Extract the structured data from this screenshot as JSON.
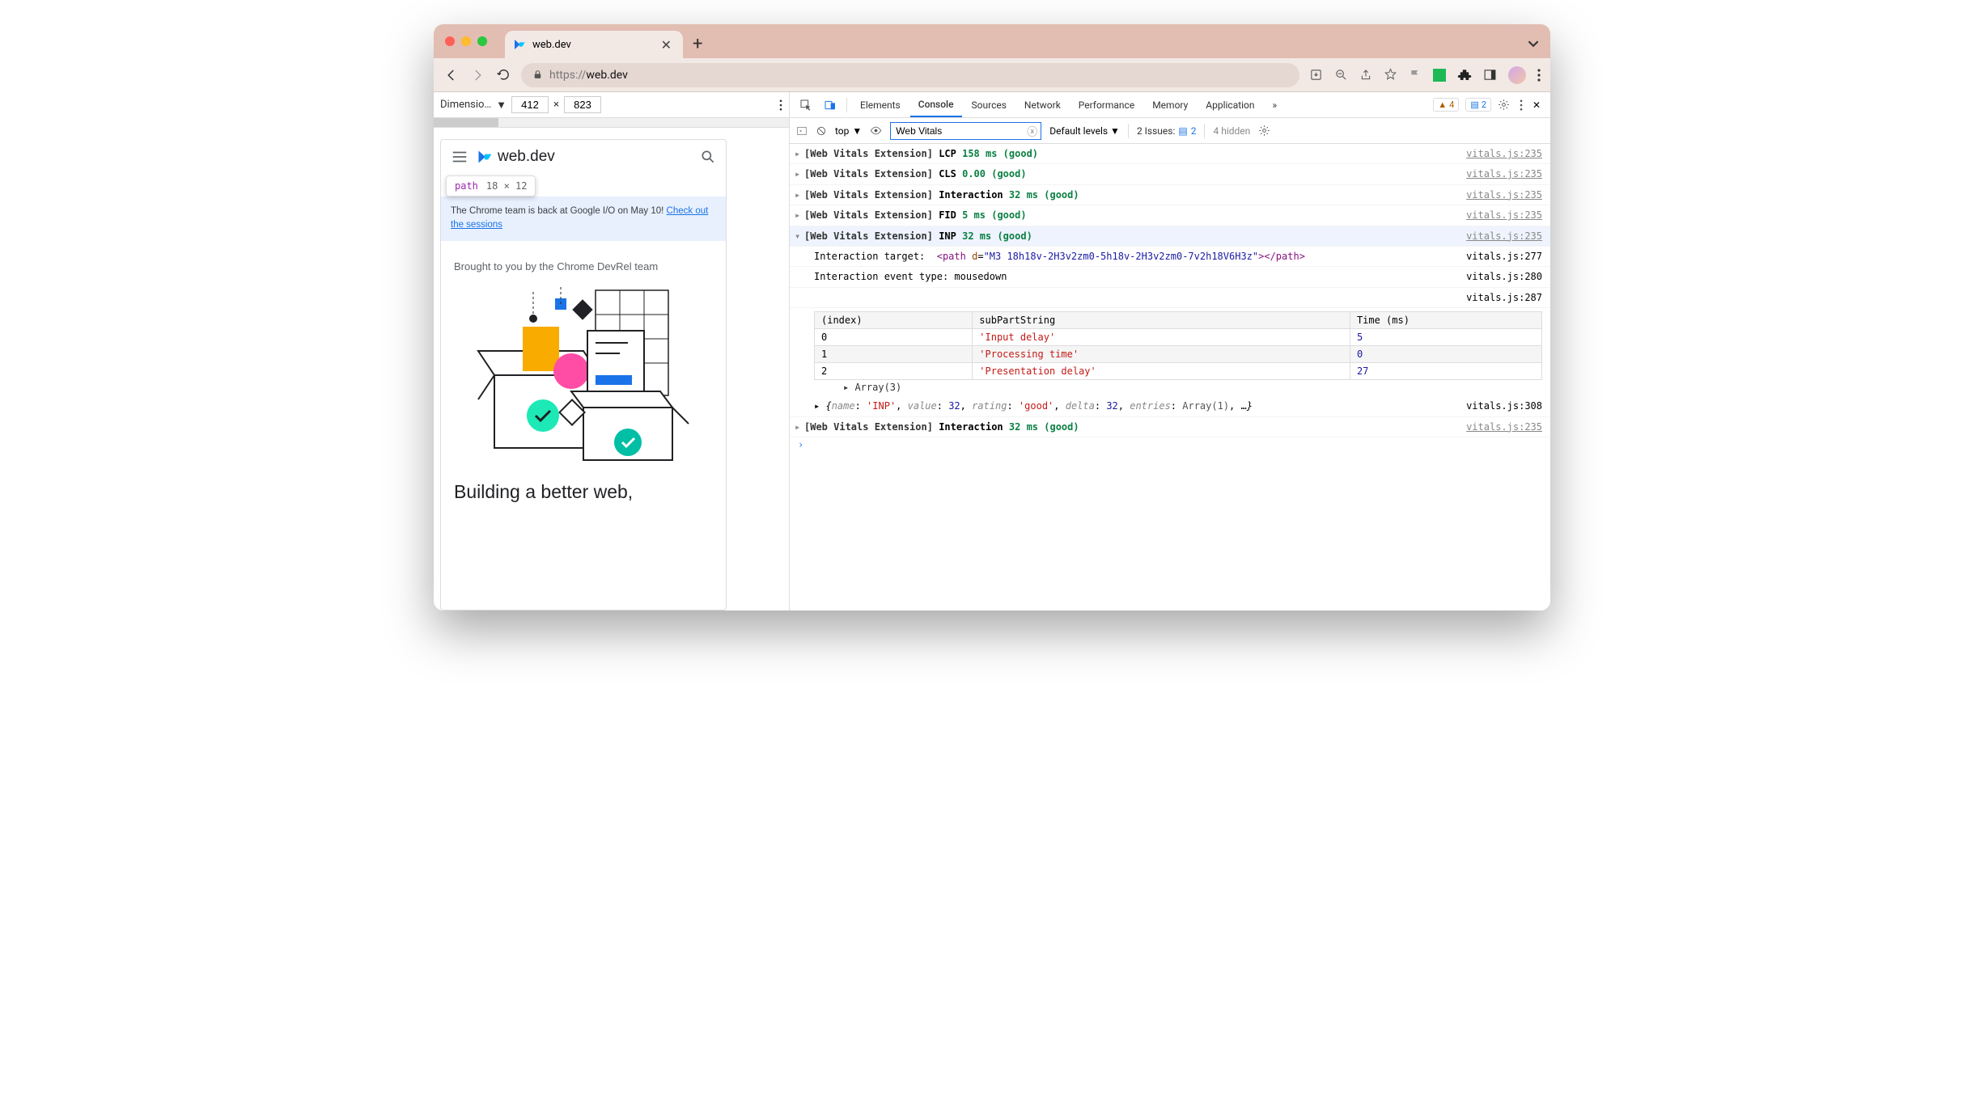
{
  "browser": {
    "tab_title": "web.dev",
    "url": "https://web.dev",
    "url_prefix": "https://"
  },
  "dimensions": {
    "label": "Dimensio…",
    "width": "412",
    "separator": "×",
    "height": "823"
  },
  "tooltip": {
    "tag": "path",
    "dims": "18 × 12"
  },
  "preview": {
    "brand": "web.dev",
    "banner_text": "The Chrome team is back at Google I/O on May 10! ",
    "banner_link": "Check out the sessions",
    "subtitle": "Brought to you by the Chrome DevRel team",
    "headline": "Building a better web,"
  },
  "devtools": {
    "panels": [
      "Elements",
      "Console",
      "Sources",
      "Network",
      "Performance",
      "Memory",
      "Application"
    ],
    "active_panel": "Console",
    "badges": {
      "warn": "4",
      "info": "2"
    },
    "context": "top",
    "filter": "Web Vitals",
    "levels": "Default levels",
    "issues_label": "2 Issues:",
    "issues_count": "2",
    "hidden": "4 hidden"
  },
  "logs": [
    {
      "prefix": "[Web Vitals Extension]",
      "metric": "LCP",
      "value": "158 ms (good)",
      "src": "vitals.js:235"
    },
    {
      "prefix": "[Web Vitals Extension]",
      "metric": "CLS",
      "value": "0.00 (good)",
      "src": "vitals.js:235"
    },
    {
      "prefix": "[Web Vitals Extension]",
      "metric": "Interaction",
      "value": "32 ms (good)",
      "src": "vitals.js:235"
    },
    {
      "prefix": "[Web Vitals Extension]",
      "metric": "FID",
      "value": "5 ms (good)",
      "src": "vitals.js:235"
    }
  ],
  "expanded": {
    "prefix": "[Web Vitals Extension]",
    "metric": "INP",
    "value": "32 ms (good)",
    "src": "vitals.js:235",
    "target_label": "Interaction target:",
    "target_html": "<path d=\"M3 18h18v-2H3v2zm0-5h18v-2H3v2zm0-7v2h18V6H3z\"></path>",
    "target_src": "vitals.js:277",
    "event_label": "Interaction event type:",
    "event_type": "mousedown",
    "event_src": "vitals.js:280",
    "table_src": "vitals.js:287",
    "table": {
      "headers": [
        "(index)",
        "subPartString",
        "Time (ms)"
      ],
      "rows": [
        [
          "0",
          "'Input delay'",
          "5"
        ],
        [
          "1",
          "'Processing time'",
          "0"
        ],
        [
          "2",
          "'Presentation delay'",
          "27"
        ]
      ],
      "footer": "Array(3)"
    },
    "obj": "{name: 'INP', value: 32, rating: 'good', delta: 32, entries: Array(1), …}",
    "obj_src": "vitals.js:308"
  },
  "trailing": {
    "prefix": "[Web Vitals Extension]",
    "metric": "Interaction",
    "value": "32 ms (good)",
    "src": "vitals.js:235"
  }
}
